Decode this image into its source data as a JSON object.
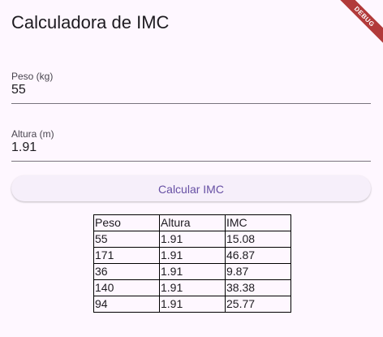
{
  "app_bar": {
    "title": "Calculadora de IMC",
    "debug_banner": "DEBUG"
  },
  "form": {
    "peso": {
      "label": "Peso (kg)",
      "value": "55"
    },
    "altura": {
      "label": "Altura (m)",
      "value": "1.91"
    },
    "calculate_button_label": "Calcular IMC"
  },
  "results": {
    "headers": [
      "Peso",
      "Altura",
      "IMC"
    ],
    "rows": [
      [
        "55",
        "1.91",
        "15.08"
      ],
      [
        "171",
        "1.91",
        "46.87"
      ],
      [
        "36",
        "1.91",
        "9.87"
      ],
      [
        "140",
        "1.91",
        "38.38"
      ],
      [
        "94",
        "1.91",
        "25.77"
      ]
    ]
  },
  "colors": {
    "background": "#FEF7FF",
    "primary": "#6750A4",
    "button_surface": "#F6EFFA",
    "debug_banner": "#B23A3A"
  }
}
